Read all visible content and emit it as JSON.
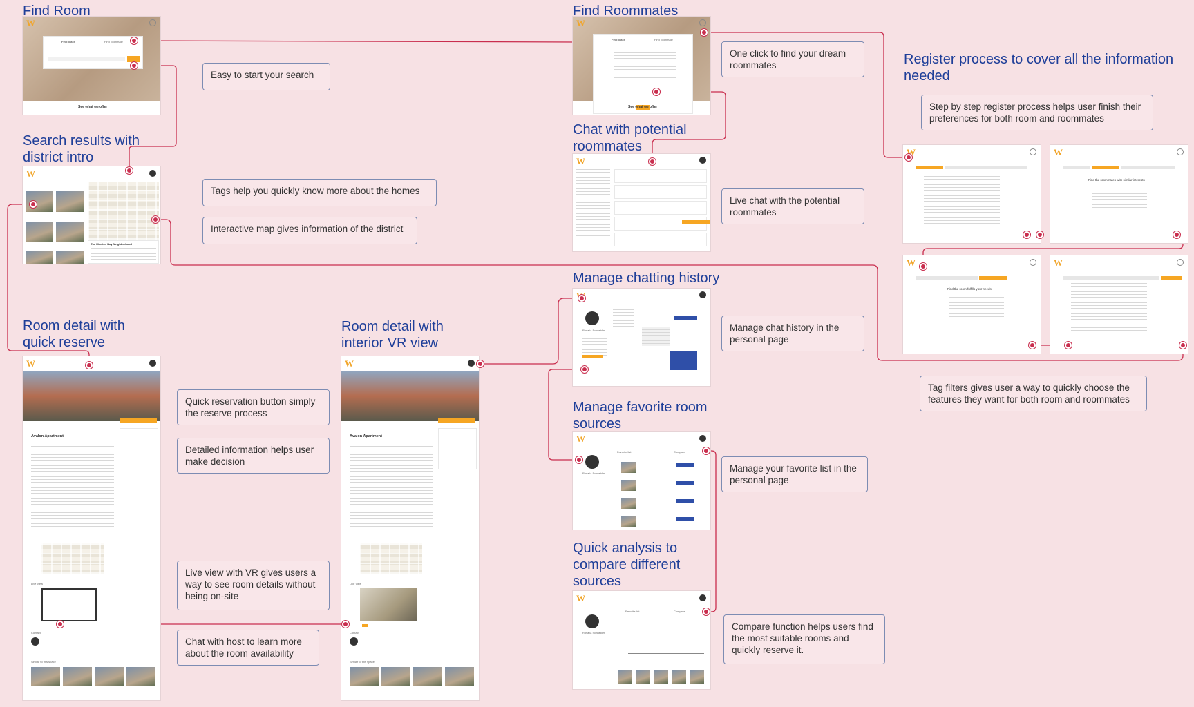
{
  "titles": {
    "find_room": "Find Room",
    "find_roommates": "Find Roommates",
    "register": "Register process to cover all the information needed",
    "search_results": "Search results with district intro",
    "chat": "Chat with potential roommates",
    "manage_history": "Manage chatting history",
    "room_detail_reserve": "Room detail with quick reserve",
    "room_detail_vr": "Room detail with interior VR view",
    "manage_favorite": "Manage favorite room sources",
    "quick_analysis": "Quick analysis to compare different sources"
  },
  "callouts": {
    "easy_search": "Easy to start your search",
    "dream_roommates": "One click to find your dream roommates",
    "step_register": "Step by step register process helps user finish their preferences for both room and roommates",
    "tags_homes": "Tags help you quickly know more about the homes",
    "interactive_map": "Interactive map gives information of the district",
    "live_chat": "Live chat with the  potential roommates",
    "manage_chat": "Manage chat history in the personal page",
    "tag_filters": "Tag filters gives user a way to quickly choose the features they want for both room and roommates",
    "quick_reservation": "Quick reservation button simply the reserve process",
    "detailed_info": "Detailed information helps user make decision",
    "favorite_list": "Manage your favorite list in the personal page",
    "live_vr": "Live view with VR gives users a way to see room details without being on-site",
    "chat_host": "Chat with host to learn more about the room availability",
    "compare_fn": "Compare function helps users find the most suitable rooms and quickly reserve it."
  },
  "mock": {
    "logo": "W",
    "tab_find_place": "Find place",
    "tab_find_roommate": "Find roommate",
    "see_offer": "See what we offer",
    "apartment": "Avalon Apartment",
    "live_view": "Live View",
    "contact": "Contact",
    "similar": "Similar to this space",
    "district": "The Mission Bay Neighborhood",
    "profile_name": "Rosalia Schneider",
    "favorite_list": "Favorite list",
    "compare": "Compare",
    "step_fill_room": "Find the room fulfills your needs",
    "step_fill_roommates": "Find the roommates with similar interests"
  },
  "colors": {
    "background": "#f7e1e4",
    "title": "#1f3f99",
    "connector": "#c92e4e",
    "accent_orange": "#f6a623",
    "accent_blue": "#2f4fa8"
  }
}
